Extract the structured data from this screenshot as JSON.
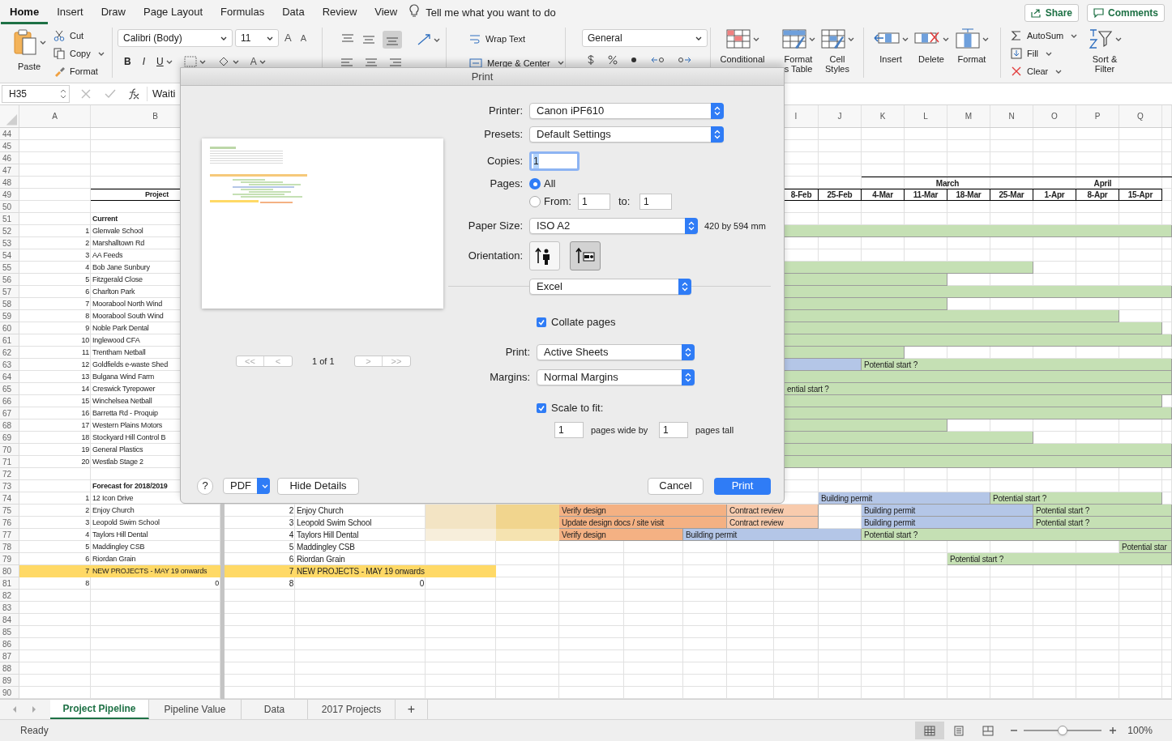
{
  "menu_tabs": [
    {
      "label": "Home",
      "selected": true
    },
    {
      "label": "Insert",
      "selected": false
    },
    {
      "label": "Draw",
      "selected": false
    },
    {
      "label": "Page Layout",
      "selected": false
    },
    {
      "label": "Formulas",
      "selected": false
    },
    {
      "label": "Data",
      "selected": false
    },
    {
      "label": "Review",
      "selected": false
    },
    {
      "label": "View",
      "selected": false
    }
  ],
  "tell_me": "Tell me what you want to do",
  "share": "Share",
  "comments": "Comments",
  "ribbon": {
    "paste": "Paste",
    "cut": "Cut",
    "copy": "Copy",
    "format_painter": "Format",
    "font_name": "Calibri (Body)",
    "font_size": "11",
    "grow_font": "A",
    "shrink_font": "A",
    "bold": "B",
    "italic": "I",
    "underline": "U",
    "font_color": "A",
    "wrap_text": "Wrap Text",
    "merge_center": "Merge & Center",
    "number_format": "General",
    "conditional": [
      "Conditional"
    ],
    "format_as_table": [
      "Format",
      "s Table"
    ],
    "cell_styles": [
      "Cell",
      "Styles"
    ],
    "insert": "Insert",
    "delete": "Delete",
    "format": "Format",
    "autosum": "AutoSum",
    "fill": "Fill",
    "clear": "Clear",
    "sort_filter": [
      "Sort &",
      "Filter"
    ]
  },
  "formula_bar": {
    "name_box": "H35",
    "content": "Waiti"
  },
  "sheet": {
    "left_columns": [
      "A",
      "B"
    ],
    "right_columns": [
      "I",
      "J",
      "K",
      "L",
      "M",
      "N",
      "O",
      "P",
      "Q"
    ],
    "rows": [
      {
        "row": "44"
      },
      {
        "row": "45"
      },
      {
        "row": "46"
      },
      {
        "row": "47"
      },
      {
        "row": "48",
        "right": {
          "K": {
            "kind": "month",
            "text": "March"
          },
          "L": {
            "kind": "more"
          },
          "M": {
            "kind": "more"
          },
          "N": {
            "kind": "more"
          },
          "O": {
            "kind": "month",
            "text": "April"
          },
          "P": {
            "kind": "more"
          },
          "Q": {
            "kind": "more"
          },
          "R": {
            "kind": "more"
          }
        }
      },
      {
        "row": "49",
        "left": {
          "B": {
            "kind": "title",
            "text": "Project"
          }
        },
        "right": {
          "I": {
            "kind": "date",
            "text": "8-Feb"
          },
          "J": {
            "kind": "date",
            "text": "25-Feb"
          },
          "K": {
            "kind": "date",
            "text": "4-Mar"
          },
          "L": {
            "kind": "date",
            "text": "11-Mar"
          },
          "M": {
            "kind": "date",
            "text": "18-Mar"
          },
          "N": {
            "kind": "date",
            "text": "25-Mar"
          },
          "O": {
            "kind": "date",
            "text": "1-Apr"
          },
          "P": {
            "kind": "date",
            "text": "8-Apr"
          },
          "Q": {
            "kind": "date",
            "text": "15-Apr"
          }
        }
      },
      {
        "row": "50"
      },
      {
        "row": "51",
        "left": {
          "B": {
            "kind": "heading",
            "text": "Current"
          }
        }
      },
      {
        "row": "52",
        "left": {
          "A": {
            "kind": "number",
            "text": "1"
          },
          "B": {
            "kind": "label",
            "text": "Glenvale School"
          }
        },
        "right": {
          "I": {
            "kind": "bar",
            "color": "#c5e0b4"
          },
          "J": {
            "kind": "more"
          },
          "K": {
            "kind": "more"
          },
          "L": {
            "kind": "more"
          },
          "M": {
            "kind": "more"
          },
          "N": {
            "kind": "more"
          },
          "O": {
            "kind": "more"
          },
          "P": {
            "kind": "more"
          },
          "Q": {
            "kind": "more"
          },
          "R": {
            "kind": "more"
          }
        }
      },
      {
        "row": "53",
        "left": {
          "A": {
            "kind": "number",
            "text": "2"
          },
          "B": {
            "kind": "label",
            "text": "Marshalltown Rd"
          }
        }
      },
      {
        "row": "54",
        "left": {
          "A": {
            "kind": "number",
            "text": "3"
          },
          "B": {
            "kind": "label",
            "text": "AA Feeds"
          }
        }
      },
      {
        "row": "55",
        "left": {
          "A": {
            "kind": "number",
            "text": "4"
          },
          "B": {
            "kind": "label",
            "text": "Bob Jane Sunbury"
          }
        },
        "right": {
          "I": {
            "kind": "bar",
            "color": "#c5e0b4"
          },
          "J": {
            "kind": "more"
          },
          "K": {
            "kind": "more"
          },
          "L": {
            "kind": "more"
          },
          "M": {
            "kind": "more"
          },
          "N": {
            "kind": "more"
          }
        }
      },
      {
        "row": "56",
        "left": {
          "A": {
            "kind": "number",
            "text": "5"
          },
          "B": {
            "kind": "label",
            "text": "Fitzgerald Close"
          }
        },
        "right": {
          "I": {
            "kind": "bar",
            "color": "#c5e0b4"
          },
          "J": {
            "kind": "more"
          },
          "K": {
            "kind": "more"
          },
          "L": {
            "kind": "more"
          }
        }
      },
      {
        "row": "57",
        "left": {
          "A": {
            "kind": "number",
            "text": "6"
          },
          "B": {
            "kind": "label",
            "text": "Charlton Park"
          }
        },
        "right": {
          "I": {
            "kind": "bar",
            "color": "#c5e0b4"
          },
          "J": {
            "kind": "more"
          },
          "K": {
            "kind": "more"
          },
          "L": {
            "kind": "more"
          },
          "M": {
            "kind": "more"
          },
          "N": {
            "kind": "more"
          },
          "O": {
            "kind": "more"
          },
          "P": {
            "kind": "more"
          },
          "Q": {
            "kind": "more"
          },
          "R": {
            "kind": "more"
          }
        }
      },
      {
        "row": "58",
        "left": {
          "A": {
            "kind": "number",
            "text": "7"
          },
          "B": {
            "kind": "label",
            "text": "Moorabool North Wind"
          }
        },
        "right": {
          "I": {
            "kind": "bar",
            "color": "#c5e0b4"
          },
          "J": {
            "kind": "more"
          },
          "K": {
            "kind": "more"
          },
          "L": {
            "kind": "more"
          }
        }
      },
      {
        "row": "59",
        "left": {
          "A": {
            "kind": "number",
            "text": "8"
          },
          "B": {
            "kind": "label",
            "text": "Moorabool South Wind"
          }
        },
        "right": {
          "I": {
            "kind": "bar",
            "color": "#c5e0b4"
          },
          "J": {
            "kind": "more"
          },
          "K": {
            "kind": "more"
          },
          "L": {
            "kind": "more"
          },
          "M": {
            "kind": "more"
          },
          "N": {
            "kind": "more"
          },
          "O": {
            "kind": "more"
          },
          "P": {
            "kind": "more"
          }
        }
      },
      {
        "row": "60",
        "left": {
          "A": {
            "kind": "number",
            "text": "9"
          },
          "B": {
            "kind": "label",
            "text": "Noble Park Dental"
          }
        },
        "right": {
          "I": {
            "kind": "bar",
            "color": "#c5e0b4"
          },
          "J": {
            "kind": "more"
          },
          "K": {
            "kind": "more"
          },
          "L": {
            "kind": "more"
          },
          "M": {
            "kind": "more"
          },
          "N": {
            "kind": "more"
          },
          "O": {
            "kind": "more"
          },
          "P": {
            "kind": "more"
          },
          "Q": {
            "kind": "more"
          }
        }
      },
      {
        "row": "61",
        "left": {
          "A": {
            "kind": "number",
            "text": "10"
          },
          "B": {
            "kind": "label",
            "text": "Inglewood CFA"
          }
        },
        "right": {
          "I": {
            "kind": "bar",
            "color": "#c5e0b4"
          },
          "J": {
            "kind": "more"
          },
          "K": {
            "kind": "more"
          },
          "L": {
            "kind": "more"
          },
          "M": {
            "kind": "more"
          },
          "N": {
            "kind": "more"
          },
          "O": {
            "kind": "more"
          },
          "P": {
            "kind": "more"
          },
          "Q": {
            "kind": "more"
          },
          "R": {
            "kind": "more"
          }
        }
      },
      {
        "row": "62",
        "left": {
          "A": {
            "kind": "number",
            "text": "11"
          },
          "B": {
            "kind": "label",
            "text": "Trentham Netball"
          }
        },
        "right": {
          "I": {
            "kind": "bar",
            "color": "#c5e0b4"
          },
          "J": {
            "kind": "more"
          },
          "K": {
            "kind": "more"
          }
        }
      },
      {
        "row": "63",
        "left": {
          "A": {
            "kind": "number",
            "text": "12"
          },
          "B": {
            "kind": "label",
            "text": "Goldfields e-waste Shed"
          }
        },
        "right": {
          "I": {
            "kind": "bar",
            "color": "#b4c6e7"
          },
          "J": {
            "kind": "more"
          },
          "K": {
            "kind": "bar",
            "color": "#c5e0b4",
            "text": "Potential start ?"
          },
          "L": {
            "kind": "more"
          },
          "M": {
            "kind": "more"
          },
          "N": {
            "kind": "more"
          },
          "O": {
            "kind": "more"
          },
          "P": {
            "kind": "more"
          },
          "Q": {
            "kind": "more"
          },
          "R": {
            "kind": "more"
          }
        }
      },
      {
        "row": "64",
        "left": {
          "A": {
            "kind": "number",
            "text": "13"
          },
          "B": {
            "kind": "label",
            "text": "Bulgana Wind Farm"
          }
        },
        "right": {
          "I": {
            "kind": "bar",
            "color": "#c5e0b4"
          },
          "J": {
            "kind": "more"
          },
          "K": {
            "kind": "more"
          },
          "L": {
            "kind": "more"
          },
          "M": {
            "kind": "more"
          },
          "N": {
            "kind": "more"
          },
          "O": {
            "kind": "more"
          },
          "P": {
            "kind": "more"
          },
          "Q": {
            "kind": "more"
          },
          "R": {
            "kind": "more"
          }
        }
      },
      {
        "row": "65",
        "left": {
          "A": {
            "kind": "number",
            "text": "14"
          },
          "B": {
            "kind": "label",
            "text": "Creswick Tyrepower"
          }
        },
        "right": {
          "I": {
            "kind": "bar",
            "color": "#c5e0b4",
            "text": "ential start ?"
          },
          "J": {
            "kind": "more"
          },
          "K": {
            "kind": "more"
          },
          "L": {
            "kind": "more"
          },
          "M": {
            "kind": "more"
          },
          "N": {
            "kind": "more"
          },
          "O": {
            "kind": "more"
          },
          "P": {
            "kind": "more"
          },
          "Q": {
            "kind": "more"
          },
          "R": {
            "kind": "more"
          }
        }
      },
      {
        "row": "66",
        "left": {
          "A": {
            "kind": "number",
            "text": "15"
          },
          "B": {
            "kind": "label",
            "text": "Winchelsea Netball"
          }
        },
        "right": {
          "I": {
            "kind": "bar",
            "color": "#c5e0b4"
          },
          "J": {
            "kind": "more"
          },
          "K": {
            "kind": "more"
          },
          "L": {
            "kind": "more"
          },
          "M": {
            "kind": "more"
          },
          "N": {
            "kind": "more"
          },
          "O": {
            "kind": "more"
          },
          "P": {
            "kind": "more"
          },
          "Q": {
            "kind": "more"
          }
        }
      },
      {
        "row": "67",
        "left": {
          "A": {
            "kind": "number",
            "text": "16"
          },
          "B": {
            "kind": "label",
            "text": "Barretta Rd - Proquip"
          }
        },
        "right": {
          "I": {
            "kind": "bar",
            "color": "#c5e0b4"
          },
          "J": {
            "kind": "more"
          },
          "K": {
            "kind": "more"
          },
          "L": {
            "kind": "more"
          },
          "M": {
            "kind": "more"
          },
          "N": {
            "kind": "more"
          },
          "O": {
            "kind": "more"
          },
          "P": {
            "kind": "more"
          },
          "Q": {
            "kind": "more"
          },
          "R": {
            "kind": "more"
          }
        }
      },
      {
        "row": "68",
        "left": {
          "A": {
            "kind": "number",
            "text": "17"
          },
          "B": {
            "kind": "label",
            "text": "Western Plains Motors"
          }
        },
        "right": {
          "I": {
            "kind": "bar",
            "color": "#c5e0b4"
          },
          "J": {
            "kind": "more"
          },
          "K": {
            "kind": "more"
          },
          "L": {
            "kind": "more"
          }
        }
      },
      {
        "row": "69",
        "left": {
          "A": {
            "kind": "number",
            "text": "18"
          },
          "B": {
            "kind": "label",
            "text": "Stockyard Hill Control B"
          }
        },
        "right": {
          "I": {
            "kind": "bar",
            "color": "#c5e0b4"
          },
          "J": {
            "kind": "more"
          },
          "K": {
            "kind": "more"
          },
          "L": {
            "kind": "more"
          },
          "M": {
            "kind": "more"
          },
          "N": {
            "kind": "more"
          }
        }
      },
      {
        "row": "70",
        "left": {
          "A": {
            "kind": "number",
            "text": "19"
          },
          "B": {
            "kind": "label",
            "text": "General Plastics"
          }
        },
        "right": {
          "I": {
            "kind": "bar",
            "color": "#c5e0b4"
          },
          "J": {
            "kind": "more"
          },
          "K": {
            "kind": "more"
          },
          "L": {
            "kind": "more"
          },
          "M": {
            "kind": "more"
          },
          "N": {
            "kind": "more"
          },
          "O": {
            "kind": "more"
          },
          "P": {
            "kind": "more"
          },
          "Q": {
            "kind": "more"
          },
          "R": {
            "kind": "more"
          }
        }
      },
      {
        "row": "71",
        "left": {
          "A": {
            "kind": "number",
            "text": "20"
          },
          "B": {
            "kind": "label",
            "text": "Westlab Stage 2"
          }
        },
        "right": {
          "I": {
            "kind": "bar",
            "color": "#c5e0b4"
          },
          "J": {
            "kind": "more"
          },
          "K": {
            "kind": "more"
          },
          "L": {
            "kind": "more"
          },
          "M": {
            "kind": "more"
          },
          "N": {
            "kind": "more"
          },
          "O": {
            "kind": "more"
          },
          "P": {
            "kind": "more"
          },
          "Q": {
            "kind": "more"
          },
          "R": {
            "kind": "more"
          }
        }
      },
      {
        "row": "72"
      },
      {
        "row": "73",
        "left": {
          "B": {
            "kind": "heading",
            "text": "Forecast for 2018/2019"
          }
        }
      },
      {
        "row": "74",
        "left": {
          "A": {
            "kind": "number",
            "text": "1"
          },
          "B": {
            "kind": "label",
            "text": "12 Icon Drive"
          }
        },
        "right": {
          "J": {
            "kind": "bar",
            "color": "#b4c6e7",
            "text": "Building permit"
          },
          "K": {
            "kind": "more"
          },
          "L": {
            "kind": "more"
          },
          "M": {
            "kind": "more"
          },
          "N": {
            "kind": "bar",
            "color": "#c5e0b4",
            "text": "Potential start ?"
          },
          "O": {
            "kind": "more"
          },
          "P": {
            "kind": "more"
          },
          "Q": {
            "kind": "more"
          }
        }
      },
      {
        "row": "75",
        "left": {
          "A": {
            "kind": "number",
            "text": "2"
          },
          "B": {
            "kind": "label",
            "text": "Enjoy Church"
          }
        },
        "right": {
          "A": {
            "kind": "number",
            "text": "2"
          },
          "B": {
            "kind": "label",
            "text": "Enjoy Church"
          },
          "C": {
            "kind": "shade",
            "color": "#f3e4c4"
          },
          "D": {
            "kind": "shade",
            "color": "#f1d58e"
          },
          "E": {
            "kind": "bar",
            "color": "#f4b183",
            "text": "Verify design"
          },
          "F": {
            "kind": "more"
          },
          "G": {
            "kind": "more"
          },
          "H": {
            "kind": "bar",
            "color": "#f8cbad",
            "text": "Contract review"
          },
          "I": {
            "kind": "more"
          },
          "K": {
            "kind": "bar",
            "color": "#b4c6e7",
            "text": "Building permit"
          },
          "L": {
            "kind": "more"
          },
          "M": {
            "kind": "more"
          },
          "N": {
            "kind": "more"
          },
          "O": {
            "kind": "bar",
            "color": "#c5e0b4",
            "text": "Potential start ?"
          },
          "P": {
            "kind": "more"
          },
          "Q": {
            "kind": "more"
          },
          "R": {
            "kind": "more"
          }
        }
      },
      {
        "row": "76",
        "left": {
          "A": {
            "kind": "number",
            "text": "3"
          },
          "B": {
            "kind": "label",
            "text": "Leopold Swim School"
          }
        },
        "right": {
          "A": {
            "kind": "number",
            "text": "3"
          },
          "B": {
            "kind": "label",
            "text": "Leopold Swim School"
          },
          "C": {
            "kind": "shade",
            "color": "#f3e4c4"
          },
          "D": {
            "kind": "shade",
            "color": "#f1d58e"
          },
          "E": {
            "kind": "bar",
            "color": "#f4b183",
            "text": "Update design docs / site visit"
          },
          "F": {
            "kind": "more"
          },
          "G": {
            "kind": "more"
          },
          "H": {
            "kind": "bar",
            "color": "#f8cbad",
            "text": "Contract review"
          },
          "I": {
            "kind": "more"
          },
          "K": {
            "kind": "bar",
            "color": "#b4c6e7",
            "text": "Building permit"
          },
          "L": {
            "kind": "more"
          },
          "M": {
            "kind": "more"
          },
          "N": {
            "kind": "more"
          },
          "O": {
            "kind": "bar",
            "color": "#c5e0b4",
            "text": "Potential start ?"
          },
          "P": {
            "kind": "more"
          },
          "Q": {
            "kind": "more"
          },
          "R": {
            "kind": "more"
          }
        }
      },
      {
        "row": "77",
        "left": {
          "A": {
            "kind": "number",
            "text": "4"
          },
          "B": {
            "kind": "label",
            "text": "Taylors Hill Dental"
          }
        },
        "right": {
          "A": {
            "kind": "number",
            "text": "4"
          },
          "B": {
            "kind": "label",
            "text": "Taylors Hill Dental"
          },
          "C": {
            "kind": "shade",
            "color": "#f7eedb"
          },
          "D": {
            "kind": "shade",
            "color": "#f5e3b0"
          },
          "E": {
            "kind": "bar",
            "color": "#f4b183",
            "text": "Verify design"
          },
          "F": {
            "kind": "more"
          },
          "G": {
            "kind": "bar",
            "color": "#b4c6e7",
            "text": "Building permit"
          },
          "H": {
            "kind": "more"
          },
          "I": {
            "kind": "more"
          },
          "J": {
            "kind": "more"
          },
          "K": {
            "kind": "bar",
            "color": "#c5e0b4",
            "text": "Potential start ?"
          },
          "L": {
            "kind": "more"
          },
          "M": {
            "kind": "more"
          },
          "N": {
            "kind": "more"
          },
          "O": {
            "kind": "more"
          },
          "P": {
            "kind": "more"
          },
          "Q": {
            "kind": "more"
          },
          "R": {
            "kind": "more"
          }
        }
      },
      {
        "row": "78",
        "left": {
          "A": {
            "kind": "number",
            "text": "5"
          },
          "B": {
            "kind": "label",
            "text": "Maddingley CSB"
          }
        },
        "right": {
          "A": {
            "kind": "number",
            "text": "5"
          },
          "B": {
            "kind": "label",
            "text": "Maddingley CSB"
          },
          "Q": {
            "kind": "bar",
            "color": "#c5e0b4",
            "text": "Potential star"
          },
          "R": {
            "kind": "more"
          }
        }
      },
      {
        "row": "79",
        "left": {
          "A": {
            "kind": "number",
            "text": "6"
          },
          "B": {
            "kind": "label",
            "text": "Riordan Grain"
          }
        },
        "right": {
          "A": {
            "kind": "number",
            "text": "6"
          },
          "B": {
            "kind": "label",
            "text": "Riordan Grain"
          },
          "M": {
            "kind": "bar",
            "color": "#c5e0b4",
            "text": "Potential start ?"
          },
          "N": {
            "kind": "more"
          },
          "O": {
            "kind": "more"
          },
          "P": {
            "kind": "more"
          },
          "Q": {
            "kind": "more"
          },
          "R": {
            "kind": "more"
          }
        }
      },
      {
        "row": "80",
        "left": {
          "A": {
            "kind": "number",
            "text": "7",
            "color": "#ffd966"
          },
          "B": {
            "kind": "label",
            "text": "NEW PROJECTS - MAY 19 onwards",
            "color": "#ffd966"
          }
        },
        "right": {
          "A": {
            "kind": "number",
            "text": "7",
            "color": "#ffd966"
          },
          "B": {
            "kind": "label",
            "text": "NEW PROJECTS - MAY 19 onwards",
            "color": "#ffd966"
          },
          "C": {
            "kind": "shade",
            "color": "#ffd966"
          }
        }
      },
      {
        "row": "81",
        "left": {
          "A": {
            "kind": "number",
            "text": "8"
          },
          "B": {
            "kind": "number",
            "text": "0"
          }
        },
        "right": {
          "A": {
            "kind": "number",
            "text": "8"
          },
          "B": {
            "kind": "number",
            "text": "0"
          }
        }
      },
      {
        "row": "82"
      },
      {
        "row": "83"
      },
      {
        "row": "84"
      },
      {
        "row": "85"
      },
      {
        "row": "86"
      },
      {
        "row": "87"
      },
      {
        "row": "88"
      },
      {
        "row": "89"
      },
      {
        "row": "90"
      }
    ]
  },
  "print_dialog": {
    "title": "Print",
    "printer": {
      "label": "Printer:",
      "value": "Canon iPF610"
    },
    "presets": {
      "label": "Presets:",
      "value": "Default Settings"
    },
    "copies": {
      "label": "Copies:",
      "value": "1"
    },
    "pages": {
      "label": "Pages:",
      "options": [
        {
          "label": "All",
          "selected": true
        },
        {
          "label": "From:",
          "selected": false
        }
      ],
      "from": "1",
      "to_label": "to:",
      "to": "1"
    },
    "paper_size": {
      "label": "Paper Size:",
      "value": "ISO A2",
      "dimensions": "420 by 594 mm"
    },
    "orientation": {
      "label": "Orientation:",
      "options": [
        {
          "kind": "portrait",
          "selected": false
        },
        {
          "kind": "landscape",
          "selected": true
        }
      ]
    },
    "section": "Excel",
    "collate": {
      "label": "Collate pages",
      "checked": true
    },
    "print_what": {
      "label": "Print:",
      "value": "Active Sheets"
    },
    "margins": {
      "label": "Margins:",
      "value": "Normal Margins"
    },
    "scale_to_fit": {
      "label": "Scale to fit:",
      "checked": true
    },
    "pages_wide": "1",
    "pages_wide_label": "pages wide by",
    "pages_tall": "1",
    "pages_tall_label": "pages tall",
    "pager": {
      "first": "<<",
      "previous": "<",
      "indicator": "1 of 1",
      "next": ">",
      "last": ">>"
    },
    "help": "?",
    "pdf": "PDF",
    "hide_details": "Hide Details",
    "cancel": "Cancel",
    "print": "Print"
  },
  "sheet_tabs": [
    {
      "label": "Project Pipeline",
      "selected": true
    },
    {
      "label": "Pipeline Value",
      "selected": false
    },
    {
      "label": "Data",
      "selected": false
    },
    {
      "label": "2017 Projects",
      "selected": false
    }
  ],
  "add_sheet": "+",
  "status_bar": {
    "text": "Ready",
    "views": [
      {
        "kind": "normal",
        "selected": true
      },
      {
        "kind": "page_layout",
        "selected": false
      },
      {
        "kind": "page_break",
        "selected": false
      }
    ],
    "zoom_slider": {
      "level": 0.5
    },
    "zoom": "100%"
  }
}
